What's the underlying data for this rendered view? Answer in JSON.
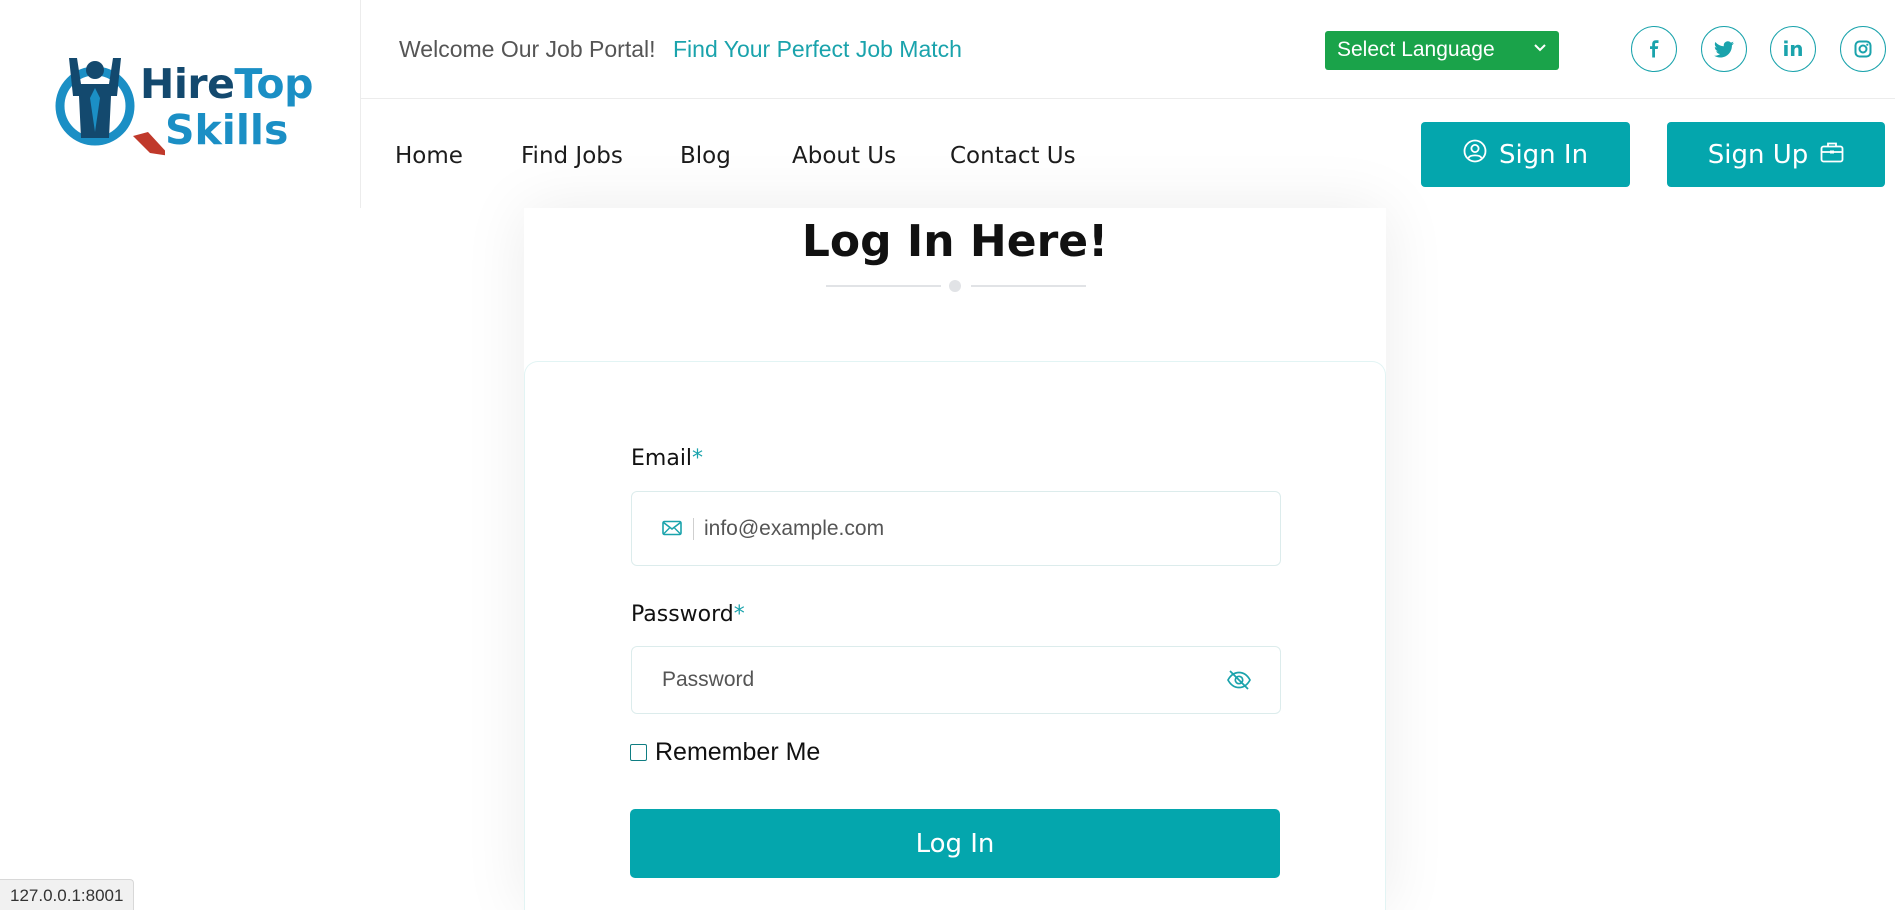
{
  "brand": {
    "name_part1": "Hire",
    "name_part2": "Top",
    "name_part3": "Skills",
    "logo_icon": "person-magnifier-logo"
  },
  "topbar": {
    "welcome": "Welcome Our Job Portal!",
    "tagline": "Find Your Perfect Job Match",
    "language": {
      "selected": "Select Language"
    },
    "social": [
      {
        "name": "facebook",
        "glyph": "f"
      },
      {
        "name": "twitter",
        "glyph": "twitter-bird"
      },
      {
        "name": "linkedin",
        "glyph": "in"
      },
      {
        "name": "instagram",
        "glyph": "camera"
      }
    ]
  },
  "nav": {
    "items": [
      "Home",
      "Find Jobs",
      "Blog",
      "About Us",
      "Contact Us"
    ],
    "sign_in": "Sign In",
    "sign_up": "Sign Up"
  },
  "login": {
    "title": "Log In Here!",
    "email_label": "Email",
    "email_placeholder": "info@example.com",
    "password_label": "Password",
    "password_placeholder": "Password",
    "required_mark": "*",
    "remember": "Remember Me",
    "submit": "Log In"
  },
  "status_bar": {
    "url": "127.0.0.1:8001"
  },
  "colors": {
    "accent": "#04a6ad",
    "language_bg": "#1aa34a",
    "brand_dark": "#13496e",
    "brand_light": "#1b8fc5"
  }
}
